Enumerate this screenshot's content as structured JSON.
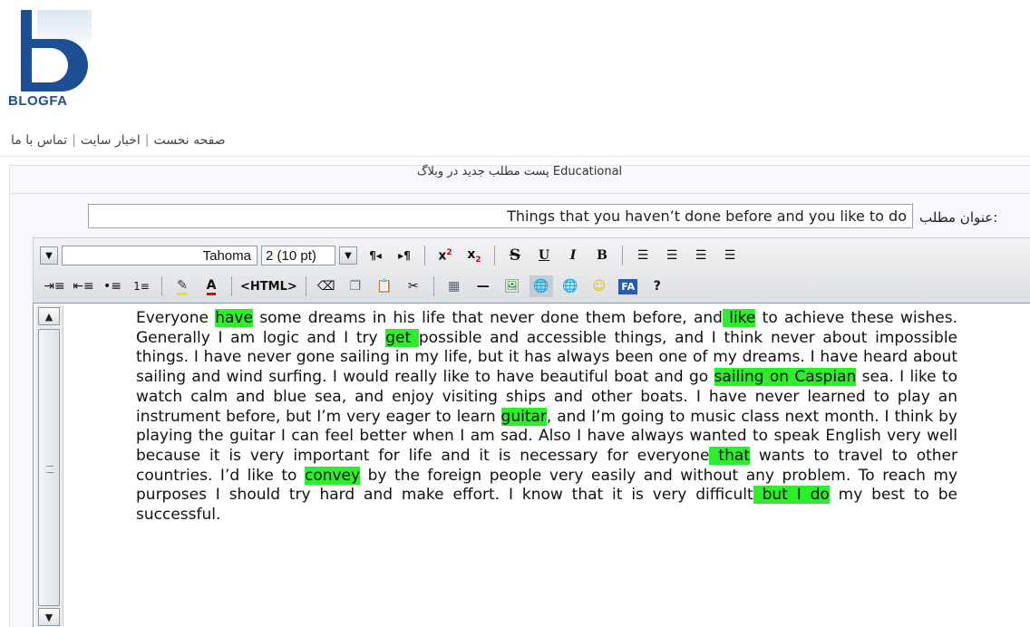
{
  "logo": {
    "wordmark": "BLOGFA"
  },
  "nav": {
    "home": "صفحه نخست",
    "news": "اخبار سایت",
    "contact": "تماس با ما"
  },
  "post_panel": {
    "heading": "پست مطلب جدید در وبلاگ Educational",
    "title_label": "عنوان مطلب:",
    "title_value": "Things that you haven’t done before and you like to do"
  },
  "toolbar": {
    "font_family": "Tahoma",
    "font_size": "2 (10 pt)",
    "html_label": "<HTML>",
    "help_label": "?",
    "fa_label": "FA"
  },
  "editor": {
    "segments": [
      {
        "t": "Everyone ",
        "hl": false
      },
      {
        "t": "have",
        "hl": true
      },
      {
        "t": " some dreams in his life that never done them before, and",
        "hl": false
      },
      {
        "t": " like",
        "hl": true
      },
      {
        "t": " to achieve these wishes. Generally I am logic and I try ",
        "hl": false
      },
      {
        "t": "get ",
        "hl": true
      },
      {
        "t": "possible and accessible things, and I think never about impossible things. I have never gone sailing in my life, but it has always been one of my dreams.  I have heard about sailing and wind surfing. I would really like to have beautiful boat and go ",
        "hl": false
      },
      {
        "t": "sailing on Caspian",
        "hl": true
      },
      {
        "t": " sea. I like to watch calm and blue sea, and enjoy visiting ships and other boats. I have never learned to play an instrument before, but I’m very eager to learn ",
        "hl": false
      },
      {
        "t": "guitar",
        "hl": true
      },
      {
        "t": ", and I’m going to music class next month. I think by playing the guitar I can feel better when I am sad. Also I have always wanted to speak English very well because it is very important for life and it is necessary for everyone",
        "hl": false
      },
      {
        "t": " that",
        "hl": true
      },
      {
        "t": " wants to travel to other countries. I’d like to ",
        "hl": false
      },
      {
        "t": "convey",
        "hl": true
      },
      {
        "t": " by the foreign people very easily and without any problem. To reach my purposes I should try hard and make effort. I know that it is very difficult",
        "hl": false
      },
      {
        "t": " but I do",
        "hl": true
      },
      {
        "t": " my best to be successful.",
        "hl": false
      }
    ]
  },
  "colors": {
    "brand": "#1c4f93",
    "highlight": "#2bef2b"
  }
}
